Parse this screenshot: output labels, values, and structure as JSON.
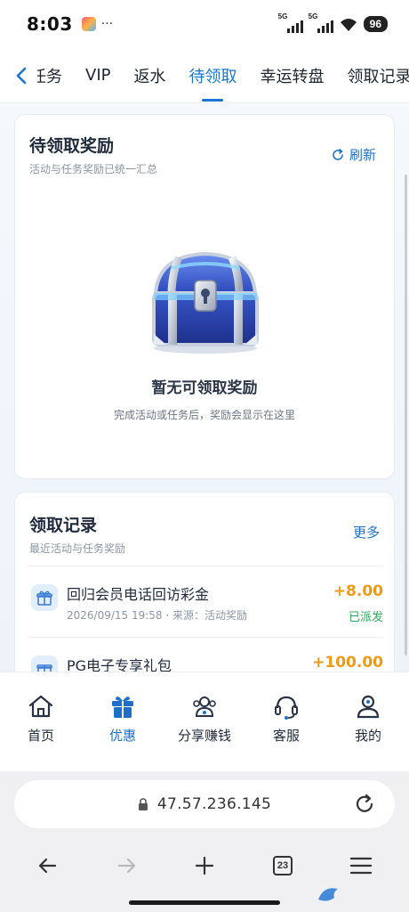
{
  "status_bar": {
    "time": "8:03",
    "dots": "···",
    "signal_1": "5G",
    "signal_2": "5G",
    "battery": "96"
  },
  "tabs": {
    "items": [
      {
        "label": "任务",
        "active": false
      },
      {
        "label": "VIP",
        "active": false
      },
      {
        "label": "返水",
        "active": false
      },
      {
        "label": "待领取",
        "active": true
      },
      {
        "label": "幸运转盘",
        "active": false
      },
      {
        "label": "领取记录",
        "active": false
      }
    ]
  },
  "pending": {
    "title": "待领取奖励",
    "subtitle": "活动与任务奖励已统一汇总",
    "refresh_label": "刷新",
    "empty_title": "暂无可领取奖励",
    "empty_desc": "完成活动或任务后，奖励会显示在这里"
  },
  "records": {
    "title": "领取记录",
    "subtitle": "最近活动与任务奖励",
    "more_label": "更多",
    "items": [
      {
        "name": "回归会员电话回访彩金",
        "meta": "2026/09/15 19:58 · 来源：活动奖励",
        "amount": "+8.00",
        "status": "已派发"
      },
      {
        "name": "PG电子专享礼包",
        "meta": "",
        "amount": "+100.00",
        "status": ""
      }
    ]
  },
  "bottom_nav": {
    "items": [
      {
        "label": "首页",
        "icon": "home-icon",
        "active": false
      },
      {
        "label": "优惠",
        "icon": "gift-icon",
        "active": true
      },
      {
        "label": "分享赚钱",
        "icon": "share-people-icon",
        "active": false
      },
      {
        "label": "客服",
        "icon": "headset-icon",
        "active": false
      },
      {
        "label": "我的",
        "icon": "user-icon",
        "active": false
      }
    ]
  },
  "browser": {
    "url": "47.57.236.145",
    "tab_count": "23"
  },
  "colors": {
    "accent": "#1976d2",
    "amount": "#ef9a16",
    "status_success": "#2ea85a"
  }
}
